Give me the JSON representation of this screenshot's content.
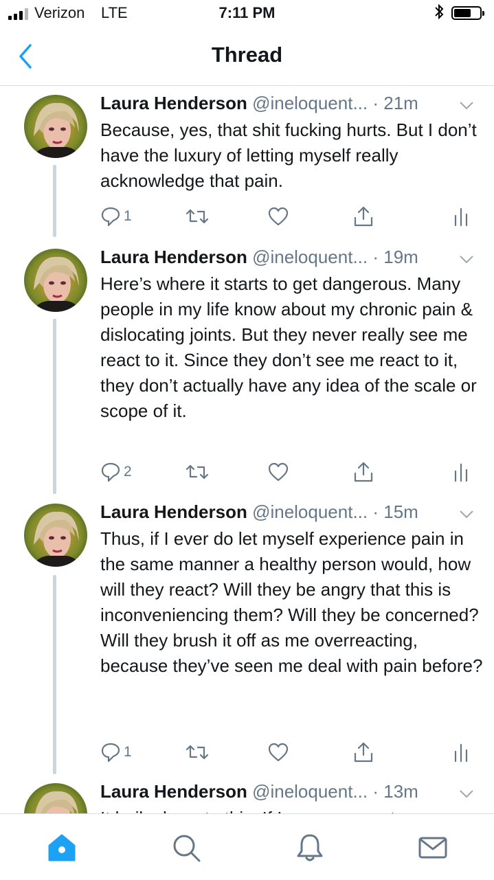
{
  "status": {
    "carrier": "Verizon",
    "network": "LTE",
    "time": "7:11 PM"
  },
  "nav": {
    "title": "Thread"
  },
  "tweets": [
    {
      "name": "Laura Henderson",
      "handle": "@ineloquent...",
      "time": "· 21m",
      "text": "Because, yes, that shit fucking hurts. But I don’t have the luxury of letting myself really acknowledge that pain.",
      "replies": "1",
      "retweets": "",
      "likes": ""
    },
    {
      "name": "Laura Henderson",
      "handle": "@ineloquent...",
      "time": "· 19m",
      "text": "Here’s where it starts to get dangerous. Many people in my life know about my chronic pain & dislocating joints. But they never really see me react to it. Since they don’t see me react to it, they don’t actually have any idea of the scale or scope of it.",
      "replies": "2",
      "retweets": "",
      "likes": ""
    },
    {
      "name": "Laura Henderson",
      "handle": "@ineloquent...",
      "time": "· 15m",
      "text": "Thus, if I ever do let myself experience pain in the same manner a healthy person would, how will they react? Will they be angry that this is inconveniencing them? Will they be concerned? Will they brush it off as me overreacting, because they’ve seen me deal with pain before?",
      "replies": "1",
      "retweets": "",
      "likes": ""
    },
    {
      "name": "Laura Henderson",
      "handle": "@ineloquent...",
      "time": "· 13m",
      "text": "It boils down to this: If I can manage to"
    }
  ],
  "icons": {
    "back": "chevron-left-icon",
    "reply": "reply-icon",
    "retweet": "retweet-icon",
    "like": "heart-icon",
    "share": "share-icon",
    "analytics": "analytics-icon",
    "home": "home-icon",
    "search": "search-icon",
    "notifications": "bell-icon",
    "messages": "mail-icon"
  },
  "colors": {
    "accent": "#1da1f2",
    "muted": "#657786",
    "thread_line": "#cbd5dd"
  }
}
